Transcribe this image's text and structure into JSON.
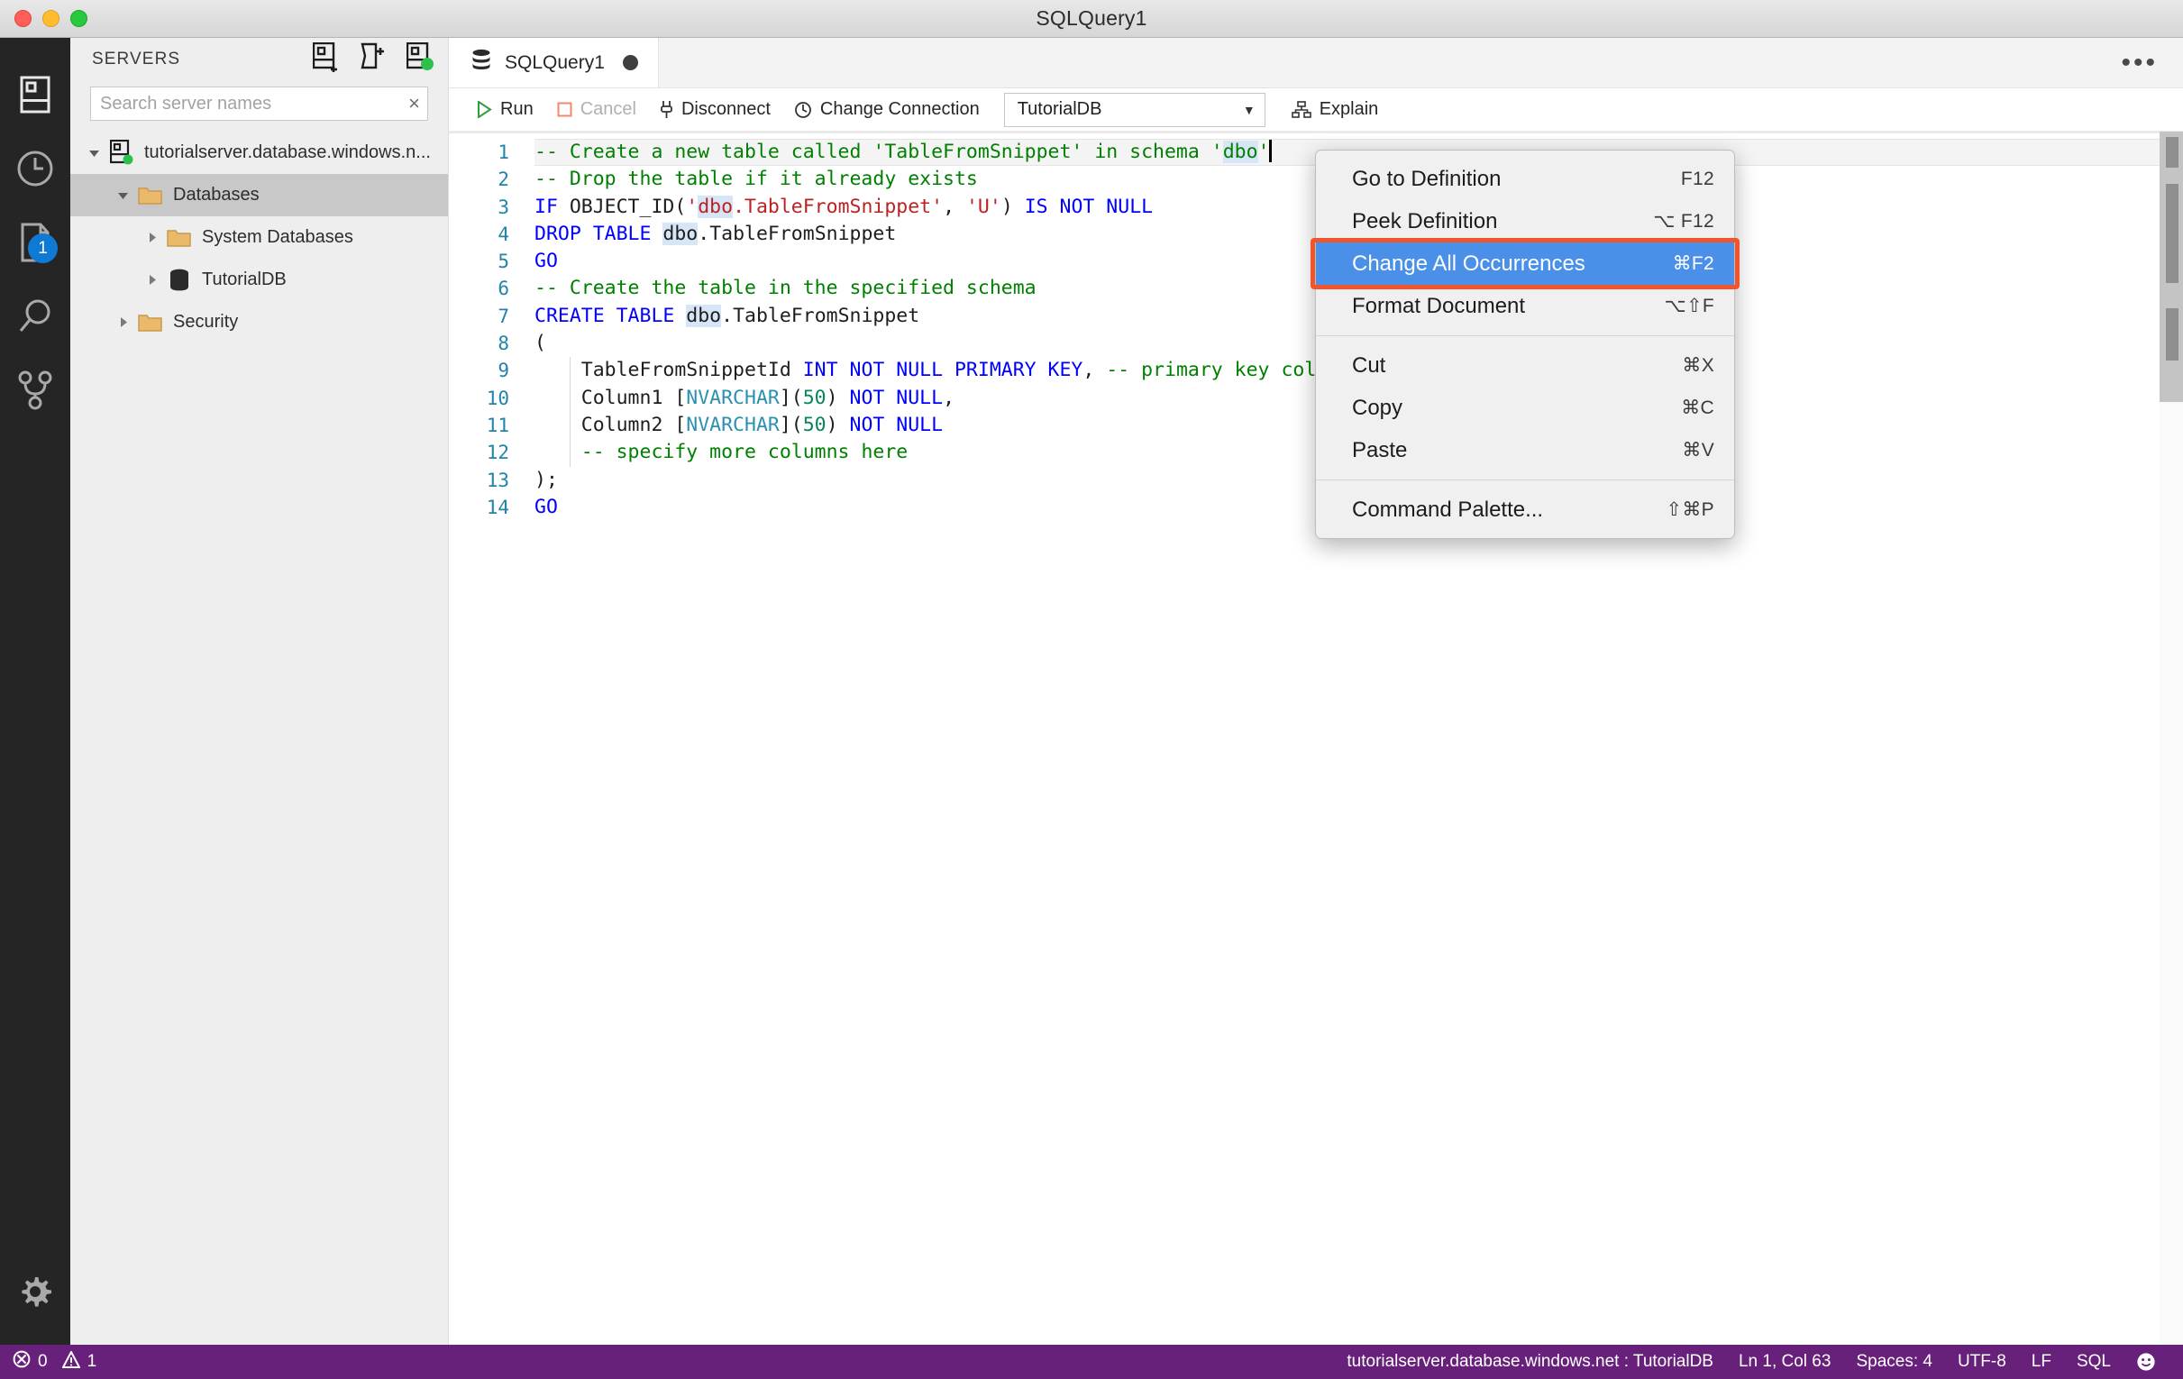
{
  "window": {
    "title": "SQLQuery1"
  },
  "activitybar": {
    "items": [
      {
        "name": "servers-icon",
        "tooltip": "Servers"
      },
      {
        "name": "history-icon",
        "tooltip": "Query History"
      },
      {
        "name": "tasks-icon",
        "tooltip": "Tasks",
        "badge": "1"
      },
      {
        "name": "search-icon",
        "tooltip": "Search"
      },
      {
        "name": "source-control-icon",
        "tooltip": "Source Control"
      }
    ],
    "bottom": {
      "name": "gear-icon",
      "tooltip": "Manage"
    }
  },
  "sidebar": {
    "title": "SERVERS",
    "actions": [
      {
        "name": "new-connection-icon",
        "tooltip": "New Connection"
      },
      {
        "name": "new-server-group-icon",
        "tooltip": "New Server Group"
      },
      {
        "name": "connected-server-icon",
        "tooltip": "Active Connections"
      }
    ],
    "search": {
      "placeholder": "Search server names",
      "value": "",
      "clear_label": "×"
    },
    "tree": [
      {
        "label": "tutorialserver.database.windows.n...",
        "icon": "server-icon",
        "expanded": true,
        "selected": false,
        "indent": 0,
        "status": "connected"
      },
      {
        "label": "Databases",
        "icon": "folder-icon",
        "expanded": true,
        "selected": true,
        "indent": 1
      },
      {
        "label": "System Databases",
        "icon": "folder-icon",
        "expanded": false,
        "selected": false,
        "indent": 2
      },
      {
        "label": "TutorialDB",
        "icon": "database-icon",
        "expanded": false,
        "selected": false,
        "indent": 2
      },
      {
        "label": "Security",
        "icon": "folder-icon",
        "expanded": false,
        "selected": false,
        "indent": 1
      }
    ]
  },
  "editor": {
    "tab": {
      "label": "SQLQuery1",
      "icon": "database-icon",
      "dirty": true
    },
    "more_actions_label": "•••",
    "toolbar": {
      "run": "Run",
      "cancel": "Cancel",
      "disconnect": "Disconnect",
      "change_connection": "Change Connection",
      "database": "TutorialDB",
      "explain": "Explain"
    },
    "active_line": 1,
    "lines": [
      {
        "n": 1,
        "tokens": [
          {
            "t": "-- Create a new table called 'TableFromSnippet' in schema '",
            "c": "cmt"
          },
          {
            "t": "dbo",
            "c": "cmt occ"
          },
          {
            "t": "'",
            "c": "cmt"
          }
        ],
        "caret_after": true
      },
      {
        "n": 2,
        "tokens": [
          {
            "t": "-- Drop the table if it already exists",
            "c": "cmt"
          }
        ]
      },
      {
        "n": 3,
        "tokens": [
          {
            "t": "IF",
            "c": "kw"
          },
          {
            "t": " OBJECT_ID(",
            "c": ""
          },
          {
            "t": "'",
            "c": "str"
          },
          {
            "t": "dbo",
            "c": "str occ"
          },
          {
            "t": ".TableFromSnippet'",
            "c": "str"
          },
          {
            "t": ", ",
            "c": ""
          },
          {
            "t": "'U'",
            "c": "str"
          },
          {
            "t": ") ",
            "c": ""
          },
          {
            "t": "IS NOT NULL",
            "c": "kw"
          }
        ]
      },
      {
        "n": 4,
        "tokens": [
          {
            "t": "DROP TABLE",
            "c": "kw"
          },
          {
            "t": " ",
            "c": ""
          },
          {
            "t": "dbo",
            "c": "occ"
          },
          {
            "t": ".TableFromSnippet",
            "c": ""
          }
        ]
      },
      {
        "n": 5,
        "tokens": [
          {
            "t": "GO",
            "c": "kw"
          }
        ]
      },
      {
        "n": 6,
        "tokens": [
          {
            "t": "-- Create the table in the specified schema",
            "c": "cmt"
          }
        ]
      },
      {
        "n": 7,
        "tokens": [
          {
            "t": "CREATE TABLE",
            "c": "kw"
          },
          {
            "t": " ",
            "c": ""
          },
          {
            "t": "dbo",
            "c": "occ"
          },
          {
            "t": ".TableFromSnippet",
            "c": ""
          }
        ]
      },
      {
        "n": 8,
        "tokens": [
          {
            "t": "(",
            "c": ""
          }
        ]
      },
      {
        "n": 9,
        "tokens": [
          {
            "t": "    TableFromSnippetId ",
            "c": ""
          },
          {
            "t": "INT NOT NULL PRIMARY KEY",
            "c": "kw"
          },
          {
            "t": ", ",
            "c": ""
          },
          {
            "t": "-- primary key column",
            "c": "cmt"
          }
        ],
        "indent_guide": true
      },
      {
        "n": 10,
        "tokens": [
          {
            "t": "    Column1 [",
            "c": ""
          },
          {
            "t": "NVARCHAR",
            "c": "typ"
          },
          {
            "t": "](",
            "c": ""
          },
          {
            "t": "50",
            "c": "num"
          },
          {
            "t": ") ",
            "c": ""
          },
          {
            "t": "NOT NULL",
            "c": "kw"
          },
          {
            "t": ",",
            "c": ""
          }
        ],
        "indent_guide": true
      },
      {
        "n": 11,
        "tokens": [
          {
            "t": "    Column2 [",
            "c": ""
          },
          {
            "t": "NVARCHAR",
            "c": "typ"
          },
          {
            "t": "](",
            "c": ""
          },
          {
            "t": "50",
            "c": "num"
          },
          {
            "t": ") ",
            "c": ""
          },
          {
            "t": "NOT NULL",
            "c": "kw"
          }
        ],
        "indent_guide": true
      },
      {
        "n": 12,
        "tokens": [
          {
            "t": "    ",
            "c": ""
          },
          {
            "t": "-- specify more columns here",
            "c": "cmt"
          }
        ],
        "indent_guide": true
      },
      {
        "n": 13,
        "tokens": [
          {
            "t": ");",
            "c": ""
          }
        ]
      },
      {
        "n": 14,
        "tokens": [
          {
            "t": "GO",
            "c": "kw"
          }
        ]
      }
    ]
  },
  "context_menu": {
    "groups": [
      [
        {
          "label": "Go to Definition",
          "shortcut": "F12",
          "highlighted": false
        },
        {
          "label": "Peek Definition",
          "shortcut": "⌥ F12",
          "highlighted": false
        },
        {
          "label": "Change All Occurrences",
          "shortcut": "⌘F2",
          "highlighted": true
        },
        {
          "label": "Format Document",
          "shortcut": "⌥⇧F",
          "highlighted": false
        }
      ],
      [
        {
          "label": "Cut",
          "shortcut": "⌘X",
          "highlighted": false
        },
        {
          "label": "Copy",
          "shortcut": "⌘C",
          "highlighted": false
        },
        {
          "label": "Paste",
          "shortcut": "⌘V",
          "highlighted": false
        }
      ],
      [
        {
          "label": "Command Palette...",
          "shortcut": "⇧⌘P",
          "highlighted": false
        }
      ]
    ]
  },
  "annotation": {
    "color": "#f1552e",
    "target": "Change All Occurrences"
  },
  "statusbar": {
    "errors": "0",
    "warnings": "1",
    "connection": "tutorialserver.database.windows.net : TutorialDB",
    "position": "Ln 1, Col 63",
    "spaces": "Spaces: 4",
    "encoding": "UTF-8",
    "eol": "LF",
    "language": "SQL",
    "feedback_icon": "smiley-icon",
    "background": "#68217a"
  }
}
